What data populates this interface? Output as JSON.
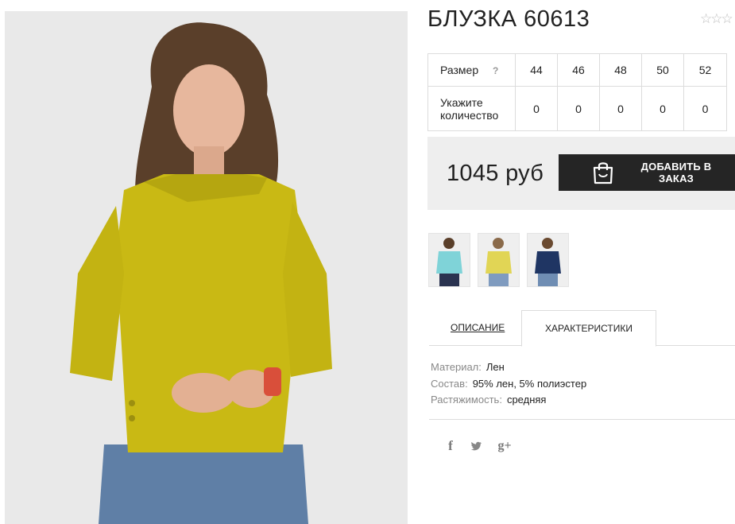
{
  "product": {
    "title": "БЛУЗКА 60613",
    "rating_stars": "☆☆☆"
  },
  "size_table": {
    "size_label": "Размер",
    "help_mark": "?",
    "sizes": [
      "44",
      "46",
      "48",
      "50",
      "52"
    ],
    "quantity_label_line1": "Укажите",
    "quantity_label_line2": "количество",
    "quantities": [
      "0",
      "0",
      "0",
      "0",
      "0"
    ]
  },
  "purchase": {
    "price": "1045 руб",
    "order_button_label": "ДОБАВИТЬ В ЗАКАЗ"
  },
  "tabs": {
    "description": "ОПИСАНИЕ",
    "characteristics": "ХАРАКТЕРИСТИКИ"
  },
  "characteristics": [
    {
      "key": "Материал:",
      "value": "Лен"
    },
    {
      "key": "Состав:",
      "value": "95% лен, 5% полиэстер"
    },
    {
      "key": "Растяжимость:",
      "value": "средняя"
    }
  ],
  "social": {
    "facebook": "f",
    "twitter": "🐦",
    "googleplus": "g+"
  },
  "colors": {
    "blouse_yellow": "#c9b914",
    "button_dark": "#252525",
    "price_bg": "#eeeeee",
    "thumb_mint": "#7fd3d8",
    "thumb_yellow": "#e1d555",
    "thumb_navy": "#1f3563"
  }
}
